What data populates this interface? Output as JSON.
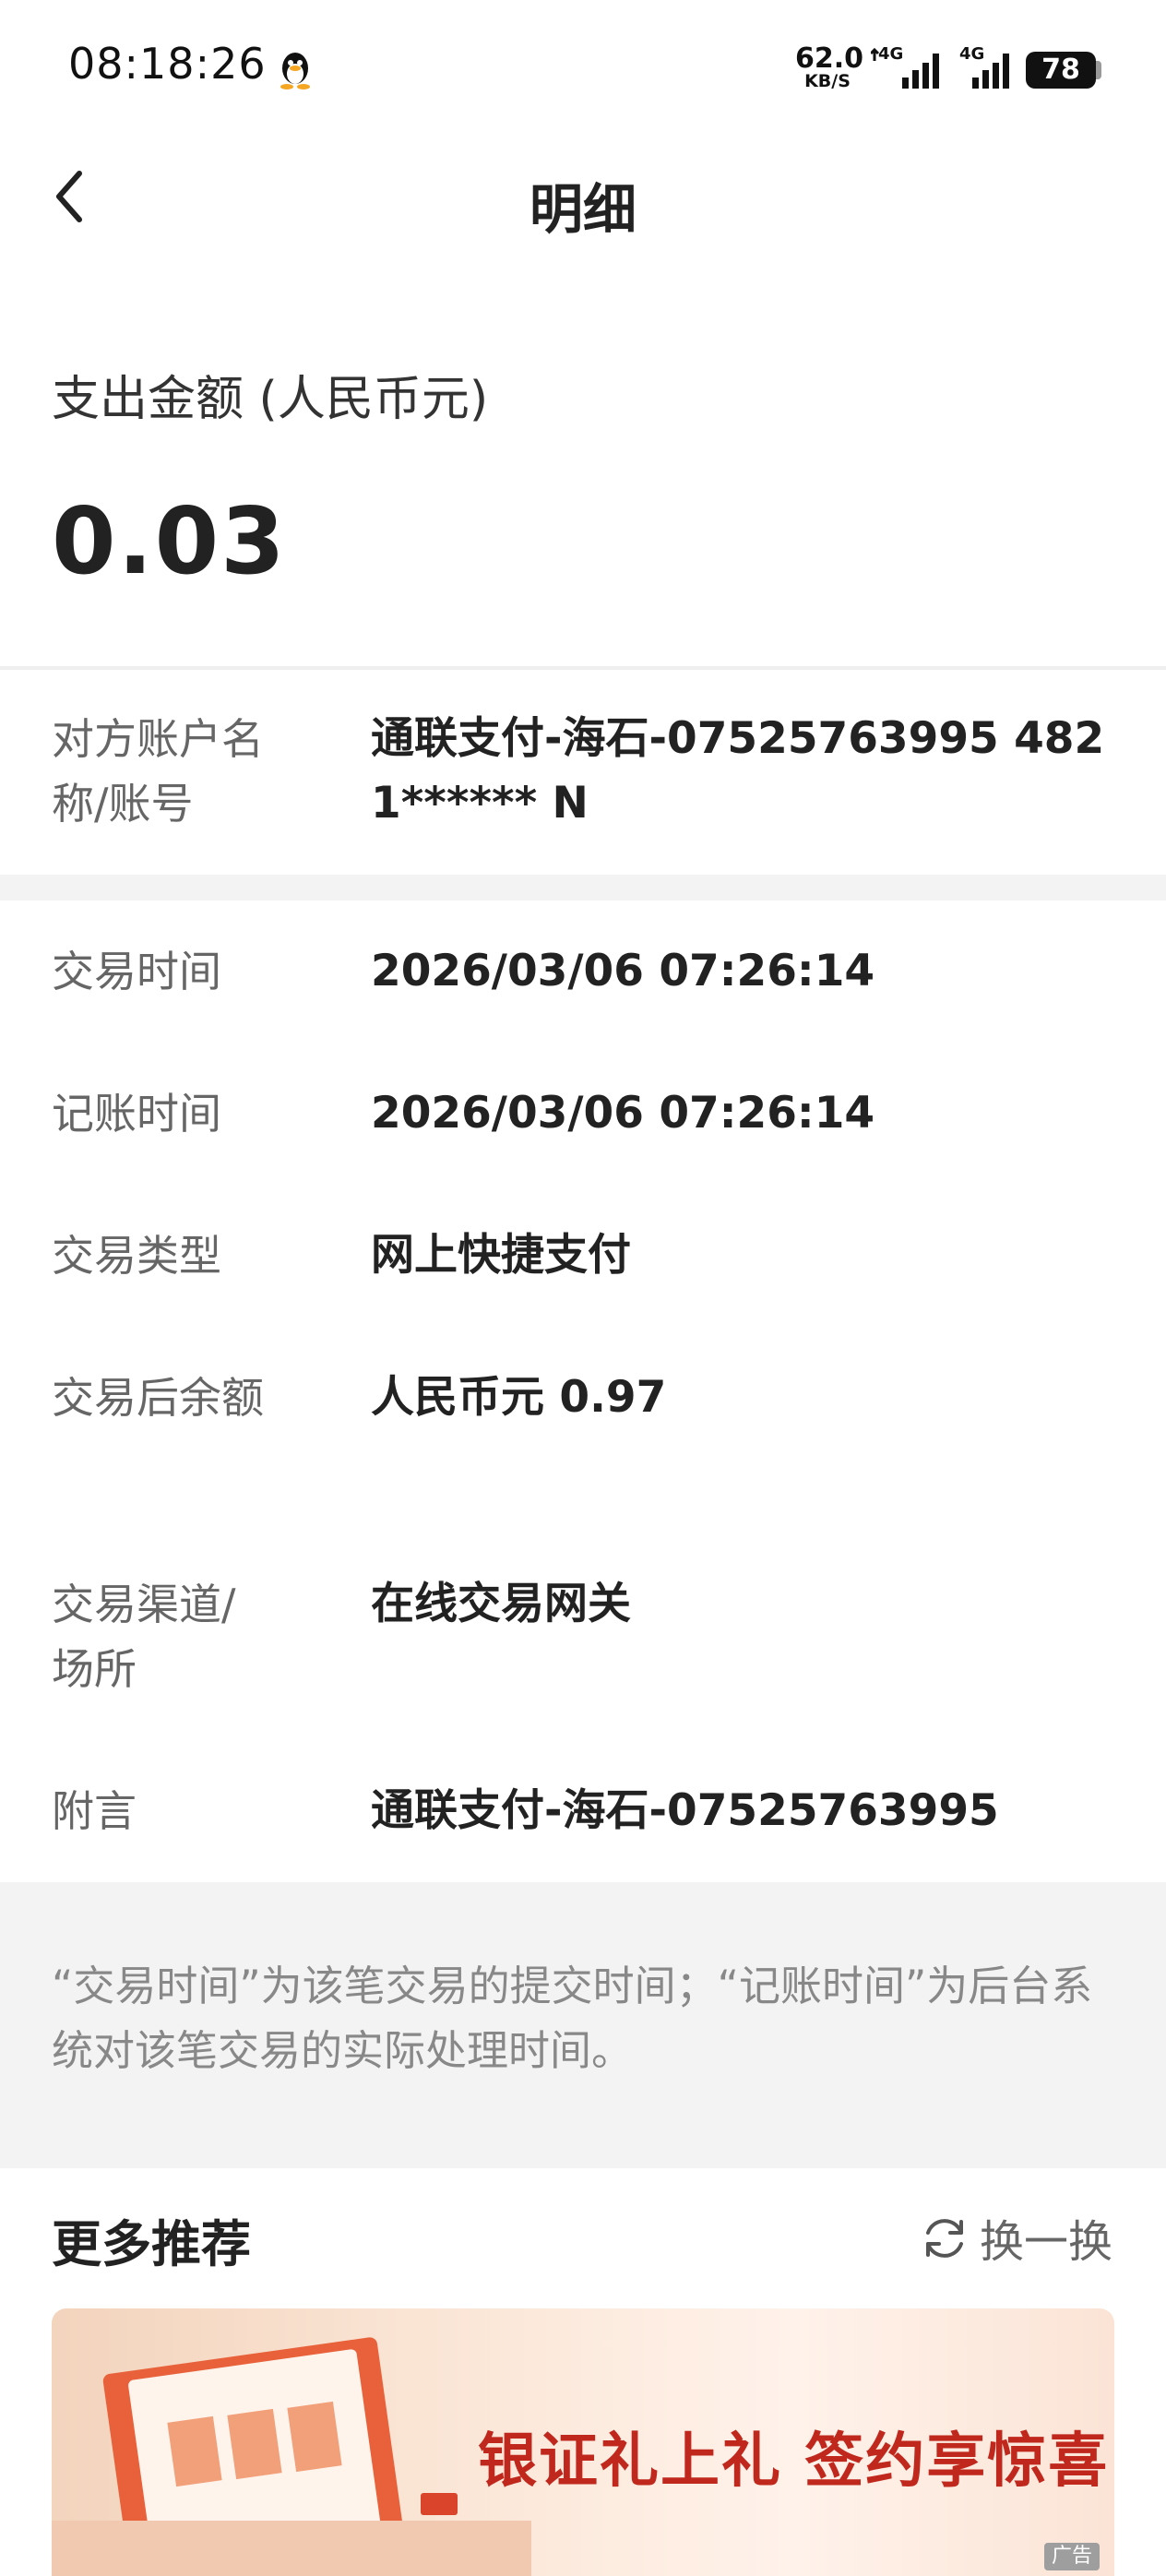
{
  "status_bar": {
    "time": "08:18:26",
    "net_speed_value": "62.0",
    "net_speed_unit": "KB/S",
    "sim1_label": "4G",
    "sim2_label": "4G",
    "battery": "78"
  },
  "header": {
    "title": "明细"
  },
  "amount": {
    "label": "支出金额 (人民币元)",
    "value": "0.03"
  },
  "counterparty": {
    "label": "对方账户名称/账号",
    "value": "通联支付-海石-07525763995 4821****** N"
  },
  "details": [
    {
      "label": "交易时间",
      "value": "2026/03/06 07:26:14"
    },
    {
      "label": "记账时间",
      "value": "2026/03/06 07:26:14"
    },
    {
      "label": "交易类型",
      "value": "网上快捷支付"
    },
    {
      "label": "交易后余额",
      "value": "人民币元 0.97"
    },
    {
      "label": "交易渠道/场所",
      "value": "在线交易网关"
    },
    {
      "label": "附言",
      "value": "通联支付-海石-07525763995"
    }
  ],
  "note": "“交易时间”为该笔交易的提交时间；“记账时间”为后台系统对该笔交易的实际处理时间。",
  "recommend": {
    "title": "更多推荐",
    "refresh_label": "换一换",
    "banner_text": "银证礼上礼 签约享惊喜",
    "ad_tag": "广告"
  },
  "colors": {
    "accent": "#c0281d",
    "background_band": "#f3f3f3",
    "label_gray": "#666666"
  }
}
